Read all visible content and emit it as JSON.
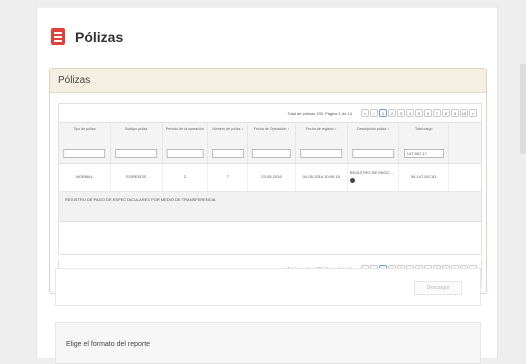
{
  "page": {
    "title": "Pólizas",
    "icon": "document-list-icon",
    "accent": "#e0403a"
  },
  "panel": {
    "title": "Pólizas"
  },
  "pager": {
    "info": "Total de pólizas 135, Página 1 de 14",
    "first": "«",
    "prev": "‹",
    "pages": [
      "1",
      "2",
      "3",
      "4",
      "5",
      "6",
      "7",
      "8",
      "9",
      "10"
    ],
    "next": "»",
    "active_page": "1"
  },
  "table": {
    "columns": [
      {
        "label": "Tipo de póliza",
        "filter": ""
      },
      {
        "label": "Subtipo póliza",
        "filter": ""
      },
      {
        "label": "Periodo de la operación",
        "filter": ""
      },
      {
        "label": "Número de póliza ↕",
        "filter": ""
      },
      {
        "label": "Fecha de Operación ↕",
        "filter": ""
      },
      {
        "label": "Fecha de registro ↕",
        "filter": ""
      },
      {
        "label": "Descripción póliza ↕",
        "filter": ""
      },
      {
        "label": "Total cargo",
        "filter": "147.967,17"
      }
    ],
    "rows": [
      {
        "cells": [
          "NORMAL",
          "EGRESOS",
          "2",
          "7",
          "23-05-2016",
          "04-05-2016 10:00:15",
          "REGISTRO DE PAGO ...",
          "54.147.557,81"
        ]
      }
    ],
    "detail": "REGISTRO DE PAGO DE ESPECTACULARES POR MEDIO DE TRANSFERENCIA"
  },
  "actions": {
    "download": "Descargar"
  },
  "report": {
    "label": "Elige el formato del reporte"
  }
}
